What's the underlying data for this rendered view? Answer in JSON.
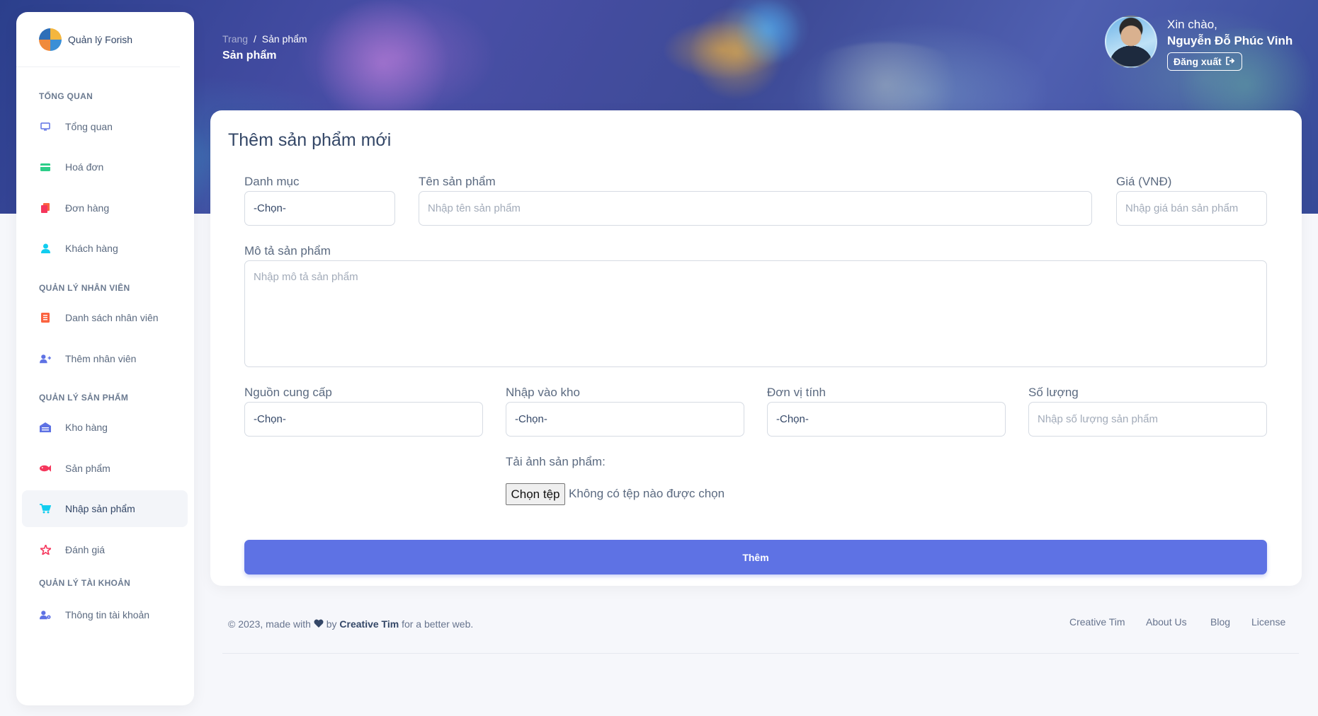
{
  "app": {
    "brand": "Quản lý Forish"
  },
  "sidebar": {
    "sections": [
      {
        "title": "TỔNG QUAN"
      },
      {
        "title": "QUẢN LÝ NHÂN VIÊN"
      },
      {
        "title": "QUẢN LÝ SẢN PHẨM"
      },
      {
        "title": "QUẢN LÝ TÀI KHOẢN"
      }
    ],
    "items": [
      {
        "label": "Tổng quan",
        "icon": "monitor-icon",
        "color": "#5e72e4"
      },
      {
        "label": "Hoá đơn",
        "icon": "credit-card-icon",
        "color": "#2dce89"
      },
      {
        "label": "Đơn hàng",
        "icon": "copy-icon",
        "color": "#f5365c"
      },
      {
        "label": "Khách hàng",
        "icon": "user-icon",
        "color": "#11cdef"
      },
      {
        "label": "Danh sách nhân viên",
        "icon": "list-icon",
        "color": "#fb6340"
      },
      {
        "label": "Thêm nhân viên",
        "icon": "user-plus-icon",
        "color": "#5e72e4"
      },
      {
        "label": "Kho hàng",
        "icon": "warehouse-icon",
        "color": "#5e72e4"
      },
      {
        "label": "Sản phẩm",
        "icon": "fish-icon",
        "color": "#f5365c"
      },
      {
        "label": "Nhập sản phẩm",
        "icon": "cart-icon",
        "color": "#11cdef"
      },
      {
        "label": "Đánh giá",
        "icon": "star-icon",
        "color": "#f5365c"
      },
      {
        "label": "Thông tin tài khoản",
        "icon": "user-gear-icon",
        "color": "#5e72e4"
      }
    ],
    "active_item": "Nhập sản phẩm"
  },
  "header": {
    "breadcrumb_root": "Trang",
    "breadcrumb_sep": "/",
    "breadcrumb_current": "Sản phẩm",
    "page_title": "Sản phẩm",
    "greeting": "Xin chào,",
    "user_name": "Nguyễn Đỗ Phúc Vinh",
    "logout_label": "Đăng xuất"
  },
  "form": {
    "title": "Thêm sản phẩm mới",
    "category_label": "Danh mục",
    "category_value": "-Chọn-",
    "name_label": "Tên sản phẩm",
    "name_placeholder": "Nhập tên sản phẩm",
    "price_label": "Giá (VNĐ)",
    "price_placeholder": "Nhập giá bán sản phẩm",
    "desc_label": "Mô tả sản phẩm",
    "desc_placeholder": "Nhập mô tả sản phẩm",
    "supplier_label": "Nguồn cung cấp",
    "supplier_value": "-Chọn-",
    "warehouse_label": "Nhập vào kho",
    "warehouse_value": "-Chọn-",
    "unit_label": "Đơn vị tính",
    "unit_value": "-Chọn-",
    "qty_label": "Số lượng",
    "qty_placeholder": "Nhập số lượng sản phẩm",
    "image_label": "Tải ảnh sản phẩm:",
    "file_button": "Chọn tệp",
    "file_status": "Không có tệp nào được chọn",
    "submit_label": "Thêm"
  },
  "footer": {
    "copyright_prefix": "© 2023, made with",
    "copyright_by": "by",
    "author": "Creative Tim",
    "copyright_suffix": "for a better web.",
    "links": [
      "Creative Tim",
      "About Us",
      "Blog",
      "License"
    ]
  },
  "colors": {
    "primary": "#5e72e4",
    "text": "#344767"
  }
}
